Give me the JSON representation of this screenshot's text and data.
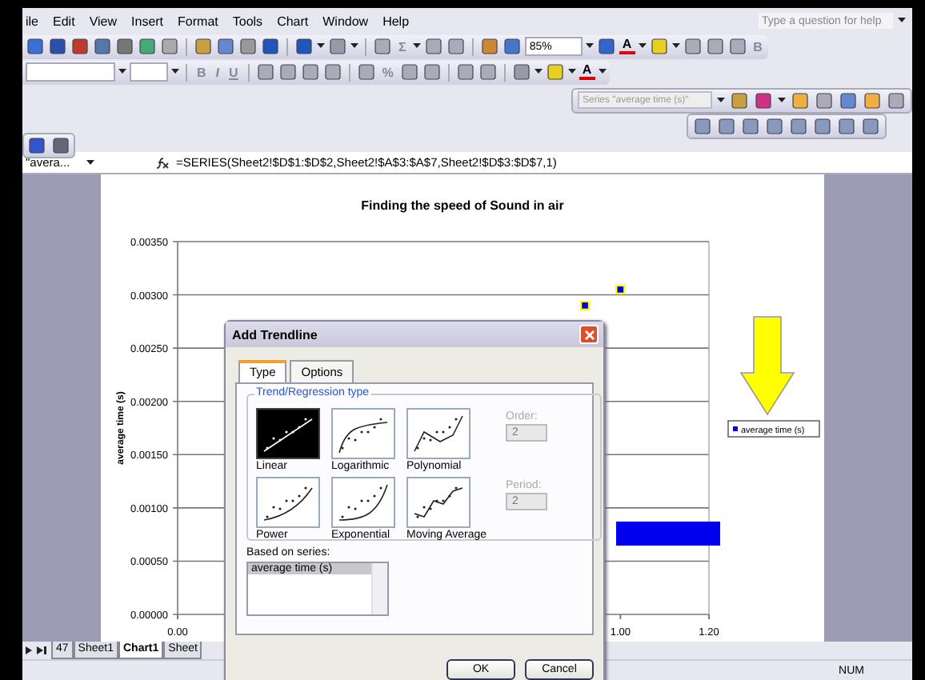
{
  "menu_bar": {
    "items": [
      "ile",
      "Edit",
      "View",
      "Insert",
      "Format",
      "Tools",
      "Chart",
      "Window",
      "Help"
    ],
    "help_search": {
      "placeholder": "Type a question for help"
    }
  },
  "standard_toolbar": {
    "sigma": "Σ",
    "zoom": "85%",
    "font_color": "A",
    "bold": "B"
  },
  "formatting_toolbar": {
    "bold": "B",
    "italic": "I",
    "underline": "U",
    "percent": "%",
    "font_color": "A"
  },
  "chart_toolbar": {
    "chart_objects": "Series \"average time (s)\""
  },
  "formula_bar": {
    "name_box": "\"avera...",
    "formula": "=SERIES(Sheet2!$D$1:$D$2,Sheet2!$A$3:$A$7,Sheet2!$D$3:$D$7,1)"
  },
  "chart": {
    "chart_data": {
      "type": "scatter",
      "title": "Finding the speed of Sound in air",
      "ylabel": "average time (s)",
      "x": [
        0.92,
        1.0
      ],
      "series": [
        {
          "name": "average time (s)",
          "color": "#0000cc",
          "values": [
            0.0029,
            0.00305
          ]
        }
      ],
      "xlim": [
        0,
        1.2
      ],
      "ylim": [
        0,
        0.0035
      ],
      "grid": true,
      "xticks": [
        {
          "value": 0,
          "label": "0.00"
        },
        {
          "value": 1.0,
          "label": "1.00"
        },
        {
          "value": 1.2,
          "label": "1.20"
        }
      ],
      "yticks": [
        {
          "value": 0,
          "label": "0.00000"
        },
        {
          "value": 0.0005,
          "label": "0.00050"
        },
        {
          "value": 0.001,
          "label": "0.00100"
        },
        {
          "value": 0.0015,
          "label": "0.00150"
        },
        {
          "value": 0.002,
          "label": "0.00200"
        },
        {
          "value": 0.0025,
          "label": "0.00250"
        },
        {
          "value": 0.003,
          "label": "0.00300"
        },
        {
          "value": 0.0035,
          "label": "0.00350"
        }
      ]
    }
  },
  "dialog": {
    "title": "Add Trendline",
    "tabs": [
      {
        "label": "Type",
        "selected": true
      },
      {
        "label": "Options",
        "selected": false
      }
    ],
    "group_title": "Trend/Regression type",
    "types": [
      {
        "label": "Linear",
        "selected": true
      },
      {
        "label": "Logarithmic",
        "selected": false
      },
      {
        "label": "Polynomial",
        "selected": false
      },
      {
        "label": "Power",
        "selected": false
      },
      {
        "label": "Exponential",
        "selected": false
      },
      {
        "label": "Moving Average",
        "selected": false
      }
    ],
    "order": {
      "label": "Order:",
      "value": "2",
      "disabled": true
    },
    "period": {
      "label": "Period:",
      "value": "2",
      "disabled": true
    },
    "series_label": "Based on series:",
    "series": [
      {
        "label": "average time (s)",
        "selected": true
      }
    ],
    "buttons": [
      "OK",
      "Cancel"
    ]
  },
  "sheet_tabs": [
    {
      "label": "47",
      "selected": false
    },
    {
      "label": "Sheet1",
      "selected": false
    },
    {
      "label": "Chart1",
      "selected": true
    },
    {
      "label": "Sheet",
      "selected": false
    }
  ],
  "status_bar": {
    "indicator": "NUM"
  }
}
